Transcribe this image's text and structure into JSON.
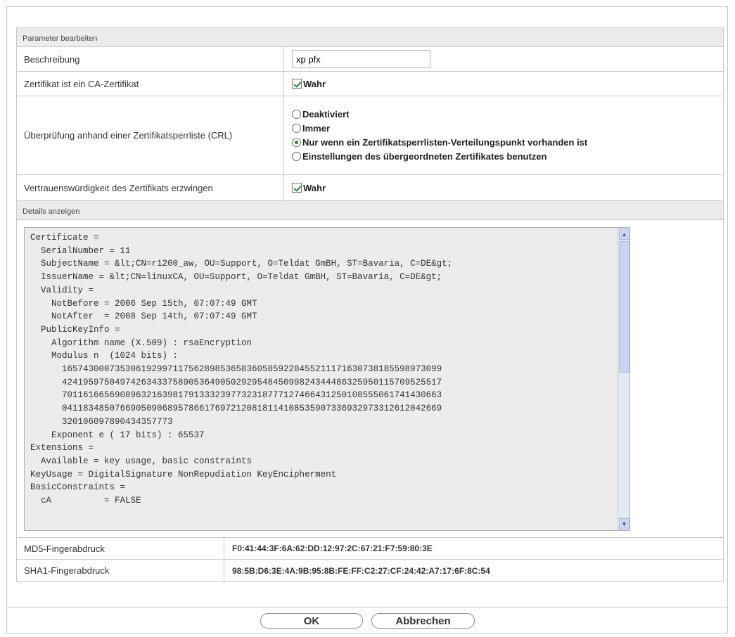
{
  "edit_section": {
    "title": "Parameter bearbeiten",
    "description_label": "Beschreibung",
    "description_value": "xp pfx",
    "ca_label": "Zertifikat ist ein CA-Zertifikat",
    "ca_checkbox_label": "Wahr",
    "crl_label": "Überprüfung anhand einer Zertifikatsperrliste (CRL)",
    "crl_options": [
      {
        "label": "Deaktiviert",
        "selected": false
      },
      {
        "label": "Immer",
        "selected": false
      },
      {
        "label": "Nur wenn ein Zertifikatsperrlisten-Verteilungspunkt vorhanden ist",
        "selected": true
      },
      {
        "label": "Einstellungen des übergeordneten Zertifikates benutzen",
        "selected": false
      }
    ],
    "trust_label": "Vertrauenswürdigkeit des Zertifikats erzwingen",
    "trust_checkbox_label": "Wahr"
  },
  "details_section": {
    "title": "Details anzeigen",
    "certificate_lines": [
      "Certificate =",
      "  SerialNumber = 11",
      "  SubjectName = &lt;CN=r1200_aw, OU=Support, O=Teldat GmBH, ST=Bavaria, C=DE&gt;",
      "  IssuerName = &lt;CN=linuxCA, OU=Support, O=Teldat GmBH, ST=Bavaria, C=DE&gt;",
      "  Validity =",
      "    NotBefore = 2006 Sep 15th, 07:07:49 GMT",
      "    NotAfter  = 2008 Sep 14th, 07:07:49 GMT",
      "  PublicKeyInfo =",
      "    Algorithm name (X.509) : rsaEncryption",
      "    Modulus n  (1024 bits) :",
      "      165743000735306192997117562898536583605859228455211171630738185598973099",
      "      424195975049742634337589053649050292954845099824344486325950115709525517",
      "      701161665690896321639817913332397732318777127466431250108555061741430663",
      "      041183485076690509068957866176972120818114108535907336932973312612042669",
      "      320106097890434357773",
      "    Exponent e ( 17 bits) : 65537",
      "Extensions =",
      "  Available = key usage, basic constraints",
      "KeyUsage = DigitalSignature NonRepudiation KeyEncipherment",
      "BasicConstraints =",
      "  cA          = FALSE"
    ],
    "md5_label": "MD5-Fingerabdruck",
    "md5_value": "F0:41:44:3F:6A:62:DD:12:97:2C:67:21:F7:59:80:3E",
    "sha1_label": "SHA1-Fingerabdruck",
    "sha1_value": "98:5B:D6:3E:4A:9B:95:8B:FE:FF:C2:27:CF:24:42:A7:17:6F:8C:54"
  },
  "buttons": {
    "ok": "OK",
    "cancel": "Abbrechen"
  },
  "icons": {
    "checkbox": "checkbox-checked-icon",
    "radio": "radio-icon",
    "scroll_up": "scroll-up-arrow-icon",
    "scroll_down": "scroll-down-arrow-icon"
  }
}
